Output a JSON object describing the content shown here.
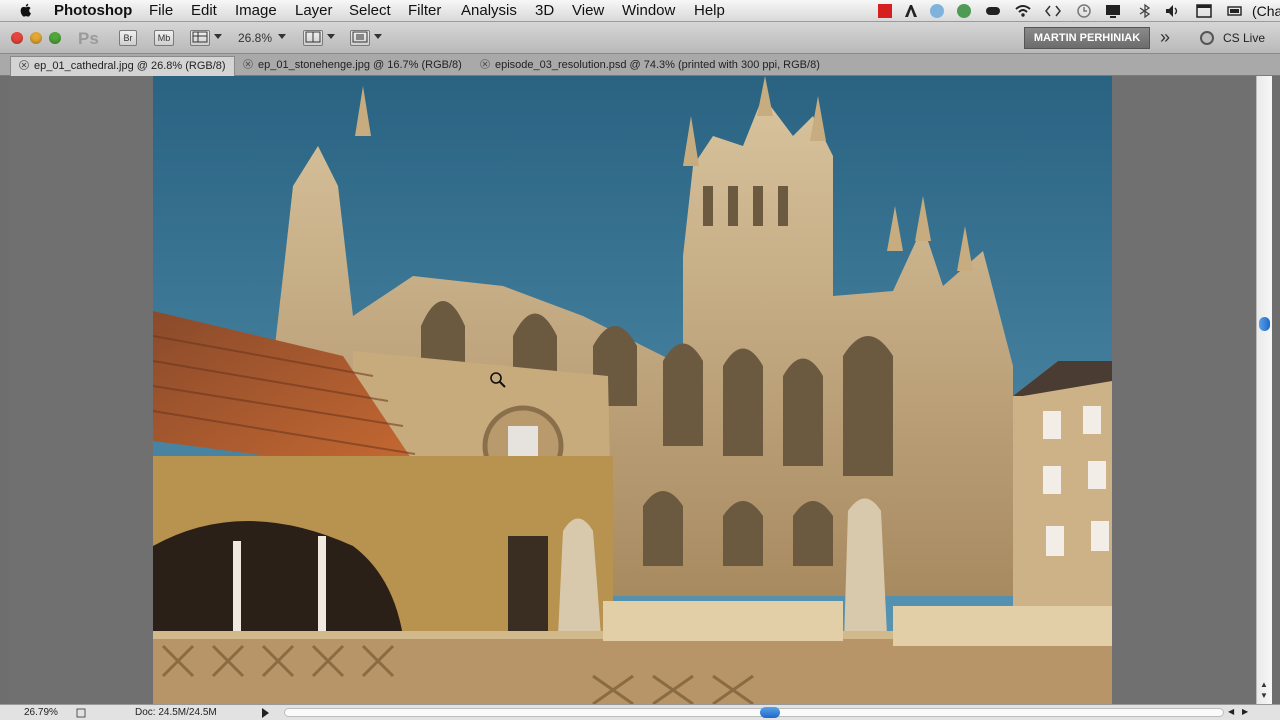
{
  "menubar": {
    "app_name": "Photoshop",
    "items": [
      "File",
      "Edit",
      "Image",
      "Layer",
      "Select",
      "Filter",
      "Analysis",
      "3D",
      "View",
      "Window",
      "Help"
    ],
    "clock_partial": "(Cha"
  },
  "appbar": {
    "logo": "Ps",
    "bridge_label": "Br",
    "minibridge_label": "Mb",
    "zoom_value": "26.8%",
    "workspace_label": "MARTIN PERHINIAK",
    "cslive_label": "CS Live"
  },
  "tabs": [
    {
      "label": "ep_01_cathedral.jpg @ 26.8% (RGB/8)",
      "active": true
    },
    {
      "label": "ep_01_stonehenge.jpg @ 16.7% (RGB/8)",
      "active": false
    },
    {
      "label": "episode_03_resolution.psd @ 74.3% (printed with 300 ppi, RGB/8)",
      "active": false
    }
  ],
  "statusbar": {
    "zoom": "26.79%",
    "doc": "Doc: 24.5M/24.5M"
  },
  "colors": {
    "sky": "#3e7fa3",
    "stone": "#c9ad82",
    "roof": "#b0552a",
    "scroll_accent": "#2f7dd6"
  },
  "icons": {
    "apple": "apple-icon",
    "close": "close-tab-icon",
    "cursor": "zoom-cursor-icon"
  }
}
